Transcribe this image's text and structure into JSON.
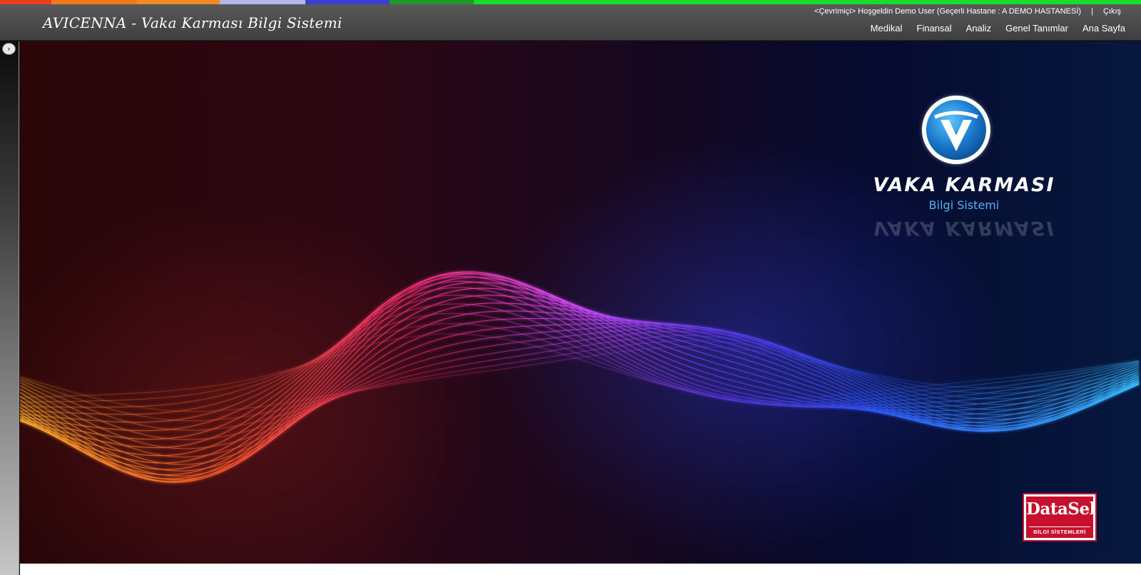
{
  "app": {
    "title": "AVICENNA - Vaka Karması Bilgi Sistemi"
  },
  "top_strip_colors": [
    "#e8401b",
    "#f07a1e",
    "#f28a2a",
    "#b6b6ee",
    "#3c3fd0",
    "#1d9a2a",
    "#17dc2a"
  ],
  "user_bar": {
    "status": "<Çevrimiçi> Hoşgeldin Demo User (Geçerli Hastane : A DEMO HASTANESİ)",
    "separator": "|",
    "logout_label": "Çıkış"
  },
  "nav": {
    "items": [
      {
        "label": "Medikal"
      },
      {
        "label": "Finansal"
      },
      {
        "label": "Analiz"
      },
      {
        "label": "Genel Tanımlar"
      },
      {
        "label": "Ana Sayfa"
      }
    ]
  },
  "sidebar": {
    "expand_icon": "chevron-right-icon",
    "expand_glyph": "›"
  },
  "brand": {
    "logo_icon": "v-shield-logo-icon",
    "title": "VAKA KARMASI",
    "subtitle": "Bilgi Sistemi"
  },
  "vendor": {
    "name": "DataSel",
    "tagline": "BİLGİ SİSTEMLERİ"
  }
}
